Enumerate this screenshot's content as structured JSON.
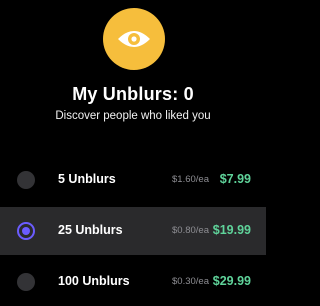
{
  "header": {
    "icon": "eye-icon",
    "icon_color": "#f6be3c",
    "title": "My Unblurs: 0",
    "subtitle": "Discover people who liked you"
  },
  "options": [
    {
      "label": "5 Unblurs",
      "per_each": "$1.60/ea",
      "price": "$7.99",
      "selected": false
    },
    {
      "label": "25 Unblurs",
      "per_each": "$0.80/ea",
      "price": "$19.99",
      "selected": true
    },
    {
      "label": "100 Unblurs",
      "per_each": "$0.30/ea",
      "price": "$29.99",
      "selected": false
    }
  ],
  "colors": {
    "accent": "#6b5cff",
    "price": "#5fd39a",
    "selected_row": "#2a2a2c"
  }
}
